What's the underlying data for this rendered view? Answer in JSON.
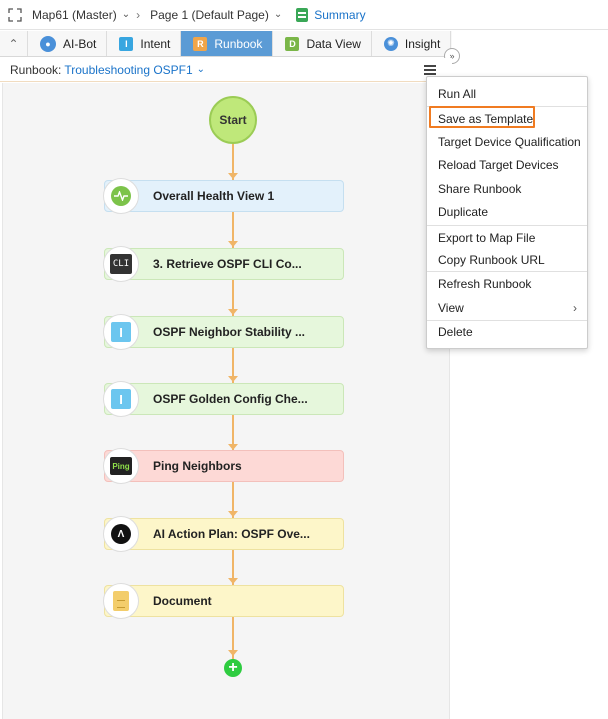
{
  "breadcrumb": {
    "map": "Map61 (Master)",
    "page": "Page 1  (Default Page)",
    "summary": "Summary"
  },
  "tabs": [
    {
      "label": "AI-Bot",
      "icon": "ai-bot-icon"
    },
    {
      "label": "Intent",
      "icon": "intent-icon"
    },
    {
      "label": "Runbook",
      "icon": "runbook-icon",
      "active": true
    },
    {
      "label": "Data View",
      "icon": "data-view-icon"
    },
    {
      "label": "Insight",
      "icon": "insight-icon"
    }
  ],
  "runbook": {
    "label": "Runbook:",
    "name": "Troubleshooting OSPF1"
  },
  "flow": {
    "start": "Start",
    "nodes": [
      {
        "label": "Overall Health View 1",
        "icon": "health-icon",
        "color": "#e3f1fb"
      },
      {
        "label": "3. Retrieve OSPF CLI Co...",
        "icon": "cli-icon",
        "icon_text": "CLI",
        "color": "#e6f7dc"
      },
      {
        "label": "OSPF Neighbor Stability ...",
        "icon": "intent-icon",
        "icon_text": "I",
        "color": "#e6f7dc"
      },
      {
        "label": "OSPF Golden Config Che...",
        "icon": "intent-icon",
        "icon_text": "I",
        "color": "#e6f7dc"
      },
      {
        "label": "Ping Neighbors",
        "icon": "ping-icon",
        "icon_text": "Ping",
        "color": "#fdd9d6"
      },
      {
        "label": "AI Action Plan: OSPF Ove...",
        "icon": "ai-icon",
        "color": "#fdf6c9"
      },
      {
        "label": "Document",
        "icon": "document-icon",
        "color": "#fdf6c9"
      }
    ]
  },
  "menu": {
    "items": [
      {
        "label": "Run All"
      },
      {
        "label": "Save as Template",
        "highlighted": true
      },
      {
        "label": "Target Device Qualification"
      },
      {
        "label": "Reload Target Devices"
      },
      {
        "label": "Share Runbook"
      },
      {
        "label": "Duplicate"
      },
      {
        "label": "Export to Map File"
      },
      {
        "label": "Copy Runbook URL"
      },
      {
        "label": "Refresh Runbook"
      },
      {
        "label": "View",
        "submenu": true
      },
      {
        "label": "Delete"
      }
    ]
  },
  "colors": {
    "accent": "#1a73c9",
    "active_tab": "#5b9bd5",
    "connector": "#f0b567",
    "highlight": "#f07b21"
  }
}
